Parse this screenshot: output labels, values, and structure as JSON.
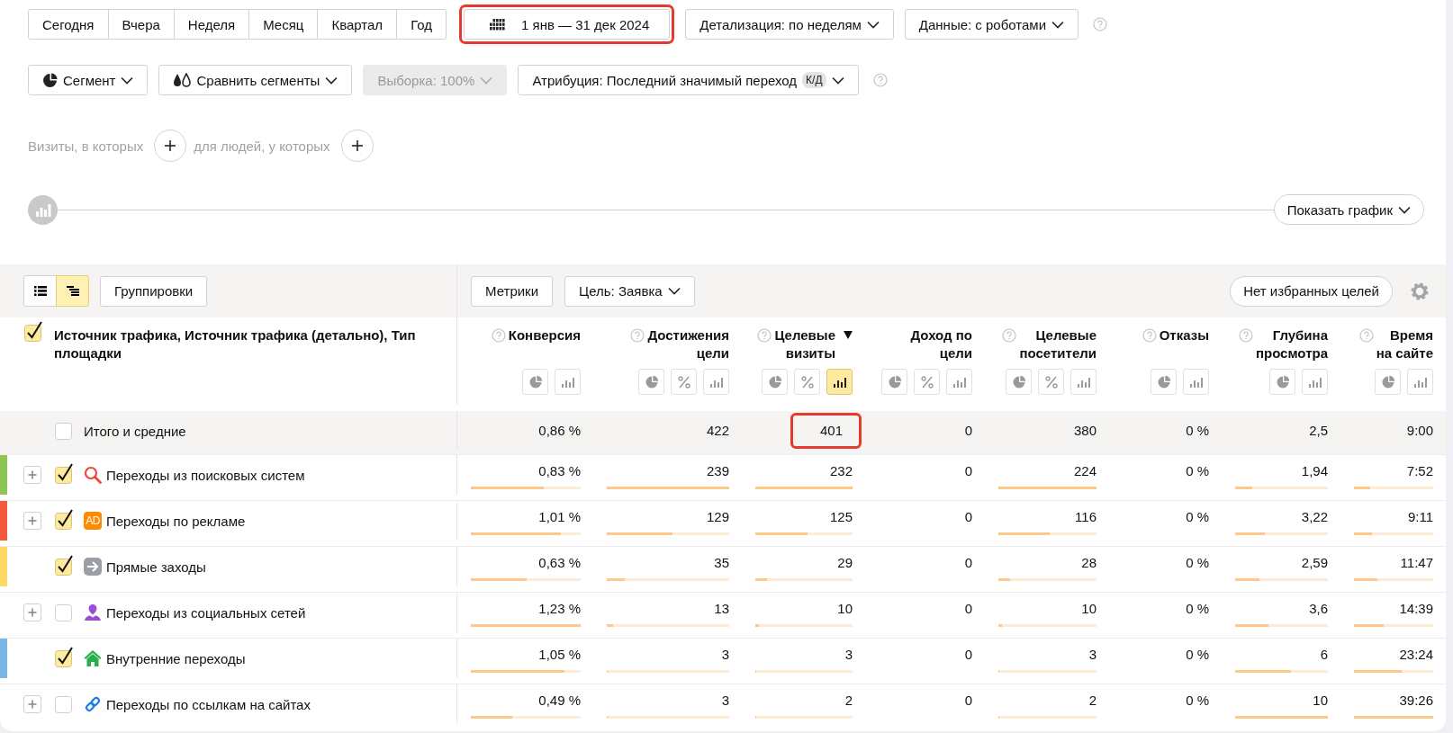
{
  "period_buttons": [
    {
      "label": "Сегодня",
      "selected": false
    },
    {
      "label": "Вчера",
      "selected": false
    },
    {
      "label": "Неделя",
      "selected": false
    },
    {
      "label": "Месяц",
      "selected": false
    },
    {
      "label": "Квартал",
      "selected": false
    },
    {
      "label": "Год",
      "selected": false
    }
  ],
  "date_range": {
    "label": "1 янв — 31 дек 2024",
    "highlighted": true
  },
  "dropdowns": [
    {
      "label": "Детализация: по неделям"
    },
    {
      "label": "Данные: с роботами"
    }
  ],
  "segment_controls": [
    {
      "kind": "segment",
      "label": "Сегмент",
      "disabled": false
    },
    {
      "kind": "compare",
      "label": "Сравнить сегменты",
      "disabled": false
    },
    {
      "kind": "sample",
      "label": "Выборка: 100%",
      "disabled": true
    },
    {
      "kind": "attribution",
      "label": "Атрибуция: Последний значимый переход",
      "badge": "К/Д",
      "disabled": false
    }
  ],
  "filters": [
    {
      "label": "Визиты, в которых"
    },
    {
      "label": "для людей, у которых"
    }
  ],
  "chart_toggle": {
    "label": "Показать график"
  },
  "toolbar": {
    "view_modes": [
      {
        "kind": "list",
        "selected": false
      },
      {
        "kind": "tree",
        "selected": true
      }
    ],
    "groupings": "Группировки",
    "metrics": "Метрики",
    "goal": "Цель: Заявка",
    "favorites": "Нет избранных целей"
  },
  "table": {
    "dimension_header": {
      "label": "Источник трафика, Источник трафика (детально), Тип площадки",
      "checked": true
    },
    "metrics": [
      {
        "label": "Конверсия",
        "help": true,
        "sorted": false,
        "views": [
          {
            "kind": "pie",
            "selected": false
          },
          {
            "kind": "bars",
            "selected": false
          }
        ]
      },
      {
        "label": "Достижения\nцели",
        "help": true,
        "sorted": false,
        "views": [
          {
            "kind": "pie",
            "selected": false
          },
          {
            "kind": "percent",
            "selected": false
          },
          {
            "kind": "bars",
            "selected": false
          }
        ]
      },
      {
        "label": "Целевые\nвизиты",
        "help": true,
        "sorted": true,
        "views": [
          {
            "kind": "pie",
            "selected": false
          },
          {
            "kind": "percent",
            "selected": false
          },
          {
            "kind": "bars",
            "selected": true
          }
        ]
      },
      {
        "label": "Доход по\nцели",
        "help": false,
        "sorted": false,
        "views": [
          {
            "kind": "pie",
            "selected": false
          },
          {
            "kind": "percent",
            "selected": false
          },
          {
            "kind": "bars",
            "selected": false
          }
        ]
      },
      {
        "label": "Целевые\nпосетители",
        "help": true,
        "sorted": false,
        "views": [
          {
            "kind": "pie",
            "selected": false
          },
          {
            "kind": "percent",
            "selected": false
          },
          {
            "kind": "bars",
            "selected": false
          }
        ]
      },
      {
        "label": "Отказы",
        "help": true,
        "sorted": false,
        "views": [
          {
            "kind": "pie",
            "selected": false
          },
          {
            "kind": "bars",
            "selected": false
          }
        ]
      },
      {
        "label": "Глубина\nпросмотра",
        "help": true,
        "sorted": false,
        "views": [
          {
            "kind": "pie",
            "selected": false
          },
          {
            "kind": "bars",
            "selected": false
          }
        ]
      },
      {
        "label": "Время\nна сайте",
        "help": true,
        "sorted": false,
        "views": [
          {
            "kind": "pie",
            "selected": false
          },
          {
            "kind": "bars",
            "selected": false
          }
        ]
      }
    ],
    "total": {
      "label": "Итого и средние",
      "checked": false,
      "values": [
        {
          "value": "0,86 %",
          "highlighted": false
        },
        {
          "value": "422",
          "highlighted": false
        },
        {
          "value": "401",
          "highlighted": true
        },
        {
          "value": "0",
          "highlighted": false
        },
        {
          "value": "380",
          "highlighted": false
        },
        {
          "value": "0 %",
          "highlighted": false
        },
        {
          "value": "2,5",
          "highlighted": false
        },
        {
          "value": "9:00",
          "highlighted": false
        }
      ]
    },
    "rows": [
      {
        "label": "Переходы из поисковых систем",
        "kind": "search",
        "expandable": true,
        "checked": true,
        "color": "#8fc653",
        "cells": [
          {
            "value": "0,83 %",
            "level": 0.66
          },
          {
            "value": "239",
            "level": 1
          },
          {
            "value": "232",
            "level": 1
          },
          {
            "value": "0"
          },
          {
            "value": "224",
            "level": 1
          },
          {
            "value": "0 %"
          },
          {
            "value": "1,94",
            "level": 0.18
          },
          {
            "value": "7:52",
            "level": 0.2
          }
        ]
      },
      {
        "label": "Переходы по рекламе",
        "kind": "ads",
        "icon_text": "AD",
        "expandable": true,
        "checked": true,
        "color": "#f5593b",
        "cells": [
          {
            "value": "1,01 %",
            "level": 0.82
          },
          {
            "value": "129",
            "level": 0.54
          },
          {
            "value": "125",
            "level": 0.54
          },
          {
            "value": "0"
          },
          {
            "value": "116",
            "level": 0.52
          },
          {
            "value": "0 %"
          },
          {
            "value": "3,22",
            "level": 0.32
          },
          {
            "value": "9:11",
            "level": 0.23
          }
        ]
      },
      {
        "label": "Прямые заходы",
        "kind": "direct",
        "expandable": false,
        "checked": true,
        "color": "#ffd966",
        "cells": [
          {
            "value": "0,63 %",
            "level": 0.51
          },
          {
            "value": "35",
            "level": 0.15
          },
          {
            "value": "29",
            "level": 0.12
          },
          {
            "value": "0"
          },
          {
            "value": "28",
            "level": 0.12
          },
          {
            "value": "0 %"
          },
          {
            "value": "2,59",
            "level": 0.26
          },
          {
            "value": "11:47",
            "level": 0.3
          }
        ]
      },
      {
        "label": "Переходы из социальных сетей",
        "kind": "social",
        "expandable": true,
        "checked": false,
        "cells": [
          {
            "value": "1,23 %",
            "level": 1
          },
          {
            "value": "13",
            "level": 0.05
          },
          {
            "value": "10",
            "level": 0.04
          },
          {
            "value": "0"
          },
          {
            "value": "10",
            "level": 0.04
          },
          {
            "value": "0 %"
          },
          {
            "value": "3,6",
            "level": 0.36
          },
          {
            "value": "14:39",
            "level": 0.37
          }
        ]
      },
      {
        "label": "Внутренние переходы",
        "kind": "internal",
        "expandable": false,
        "checked": true,
        "color": "#7ab6e6",
        "cells": [
          {
            "value": "1,05 %",
            "level": 0.85
          },
          {
            "value": "3",
            "level": 0.01
          },
          {
            "value": "3",
            "level": 0.01
          },
          {
            "value": "0"
          },
          {
            "value": "3",
            "level": 0.01
          },
          {
            "value": "0 %"
          },
          {
            "value": "6",
            "level": 0.6
          },
          {
            "value": "23:24",
            "level": 0.6
          }
        ]
      },
      {
        "label": "Переходы по ссылкам на сайтах",
        "kind": "link",
        "expandable": true,
        "checked": false,
        "cells": [
          {
            "value": "0,49 %",
            "level": 0.38
          },
          {
            "value": "3",
            "level": 0.01
          },
          {
            "value": "2",
            "level": 0.01
          },
          {
            "value": "0"
          },
          {
            "value": "2",
            "level": 0.01
          },
          {
            "value": "0 %"
          },
          {
            "value": "10",
            "level": 1
          },
          {
            "value": "39:26",
            "level": 1
          }
        ]
      }
    ]
  }
}
